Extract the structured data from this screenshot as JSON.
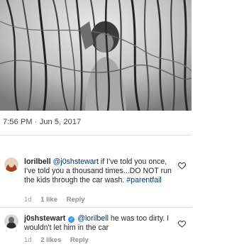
{
  "post": {
    "timestamp": "7:56 PM · Jun 5, 2017"
  },
  "comments": [
    {
      "username": "lorilbell",
      "mention": "@j0shstewart",
      "text_after_mention": " if I've told you once, I've told you a thousand times...DO NOT run the kids through the car wash. ",
      "hashtag": "#parentfail",
      "age": "1d",
      "likes": "1 like",
      "reply_label": "Reply",
      "avatar_color": "#b5532f"
    },
    {
      "username": "j0shstewart",
      "verified": true,
      "mention": "@lorilbell",
      "text_after_mention": " he was too dirty. I wouldn't let him in the car",
      "age": "1d",
      "likes": "2 likes",
      "reply_label": "Reply",
      "avatar_color": "#3a3a3a"
    }
  ],
  "icons": {
    "like": "heart-outline-icon",
    "verified": "verified-badge-icon"
  },
  "colors": {
    "link": "#003569",
    "verified": "#3897f0",
    "meta": "#999999"
  }
}
